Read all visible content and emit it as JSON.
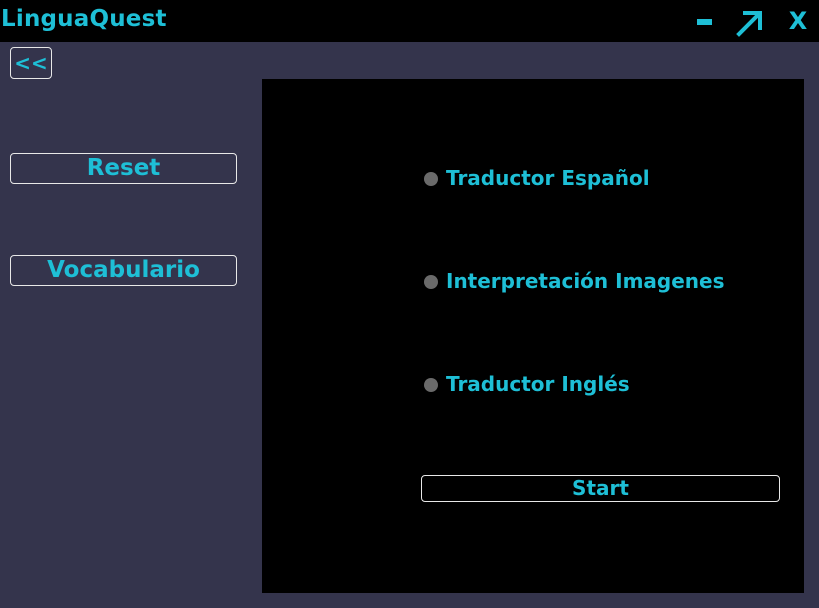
{
  "window": {
    "title": "LinguaQuest",
    "minimize_icon": "minimize-icon",
    "maximize_icon": "maximize-arrow-icon",
    "close_label": "X"
  },
  "sidebar": {
    "back_label": "<<",
    "reset_label": "Reset",
    "vocabulary_label": "Vocabulario"
  },
  "main": {
    "options": [
      {
        "label": "Traductor Español",
        "selected": false
      },
      {
        "label": "Interpretación Imagenes",
        "selected": false
      },
      {
        "label": "Traductor Inglés",
        "selected": false
      }
    ],
    "start_label": "Start"
  },
  "colors": {
    "accent": "#1ebfd6",
    "background": "#34344c",
    "panel": "#000000",
    "radio": "#6a6a6a",
    "border": "#e8e8e8"
  }
}
